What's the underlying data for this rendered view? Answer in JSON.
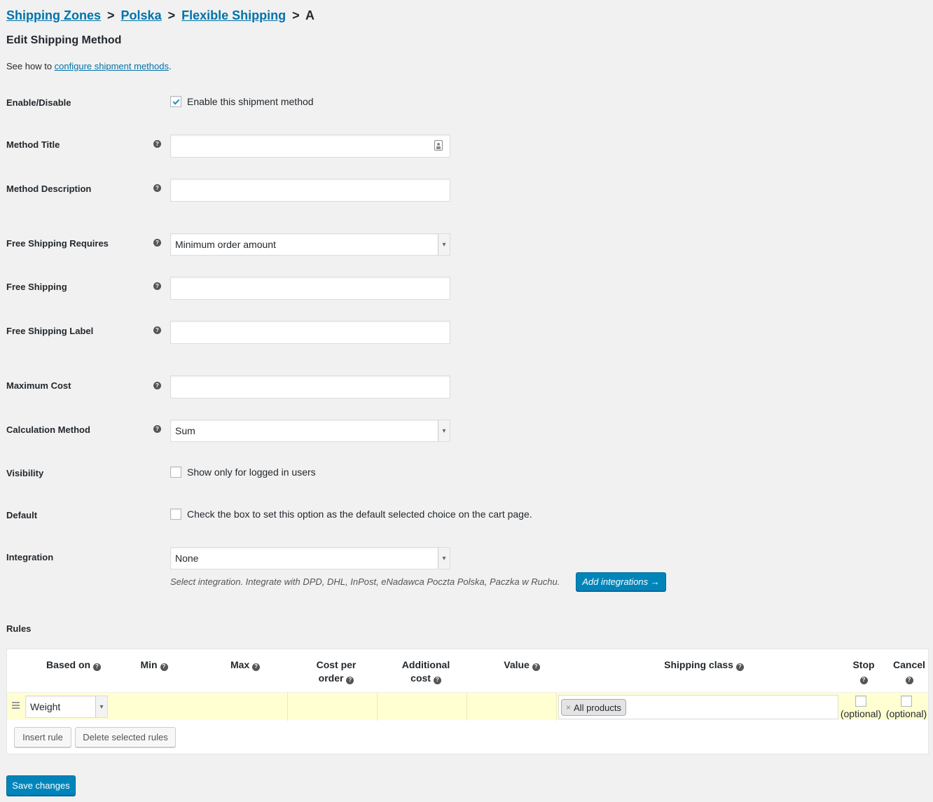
{
  "breadcrumb": {
    "zones": "Shipping Zones",
    "sep": ">",
    "zone": "Polska",
    "method": "Flexible Shipping",
    "current": "A"
  },
  "page": {
    "title": "Edit Shipping Method",
    "intro_prefix": "See how to ",
    "intro_link": "configure shipment methods",
    "intro_suffix": "."
  },
  "fields": {
    "enable": {
      "label": "Enable/Disable",
      "checkbox_label": "Enable this shipment method",
      "checked": true
    },
    "method_title": {
      "label": "Method Title",
      "value": ""
    },
    "method_description": {
      "label": "Method Description",
      "value": ""
    },
    "free_shipping_requires": {
      "label": "Free Shipping Requires",
      "value": "Minimum order amount"
    },
    "free_shipping": {
      "label": "Free Shipping",
      "value": ""
    },
    "free_shipping_label": {
      "label": "Free Shipping Label",
      "value": ""
    },
    "maximum_cost": {
      "label": "Maximum Cost",
      "value": ""
    },
    "calculation_method": {
      "label": "Calculation Method",
      "value": "Sum"
    },
    "visibility": {
      "label": "Visibility",
      "checkbox_label": "Show only for logged in users",
      "checked": false
    },
    "default": {
      "label": "Default",
      "checkbox_label": "Check the box to set this option as the default selected choice on the cart page.",
      "checked": false
    },
    "integration": {
      "label": "Integration",
      "value": "None",
      "description": "Select integration. Integrate with DPD, DHL, InPost, eNadawca Poczta Polska, Paczka w Ruchu.",
      "add_button": "Add integrations →"
    }
  },
  "help_glyph": "?",
  "rules": {
    "label": "Rules",
    "headers": {
      "based_on": "Based on",
      "min": "Min",
      "max": "Max",
      "cost_per_order_line1": "Cost per",
      "cost_per_order_line2": "order",
      "additional_cost_line1": "Additional",
      "additional_cost_line2": "cost",
      "value": "Value",
      "shipping_class": "Shipping class",
      "stop": "Stop",
      "cancel": "Cancel"
    },
    "row": {
      "based_on": "Weight",
      "min": "",
      "max": "",
      "cost_per_order": "",
      "additional_cost": "",
      "value": "",
      "shipping_class_tag": "All products",
      "tag_remove": "×",
      "stop_optional": "(optional)",
      "cancel_optional": "(optional)"
    },
    "insert_button": "Insert rule",
    "delete_button": "Delete selected rules"
  },
  "save_button": "Save changes",
  "colors": {
    "link": "#0073aa",
    "primary": "#0085ba",
    "row_highlight": "#ffffd2"
  }
}
